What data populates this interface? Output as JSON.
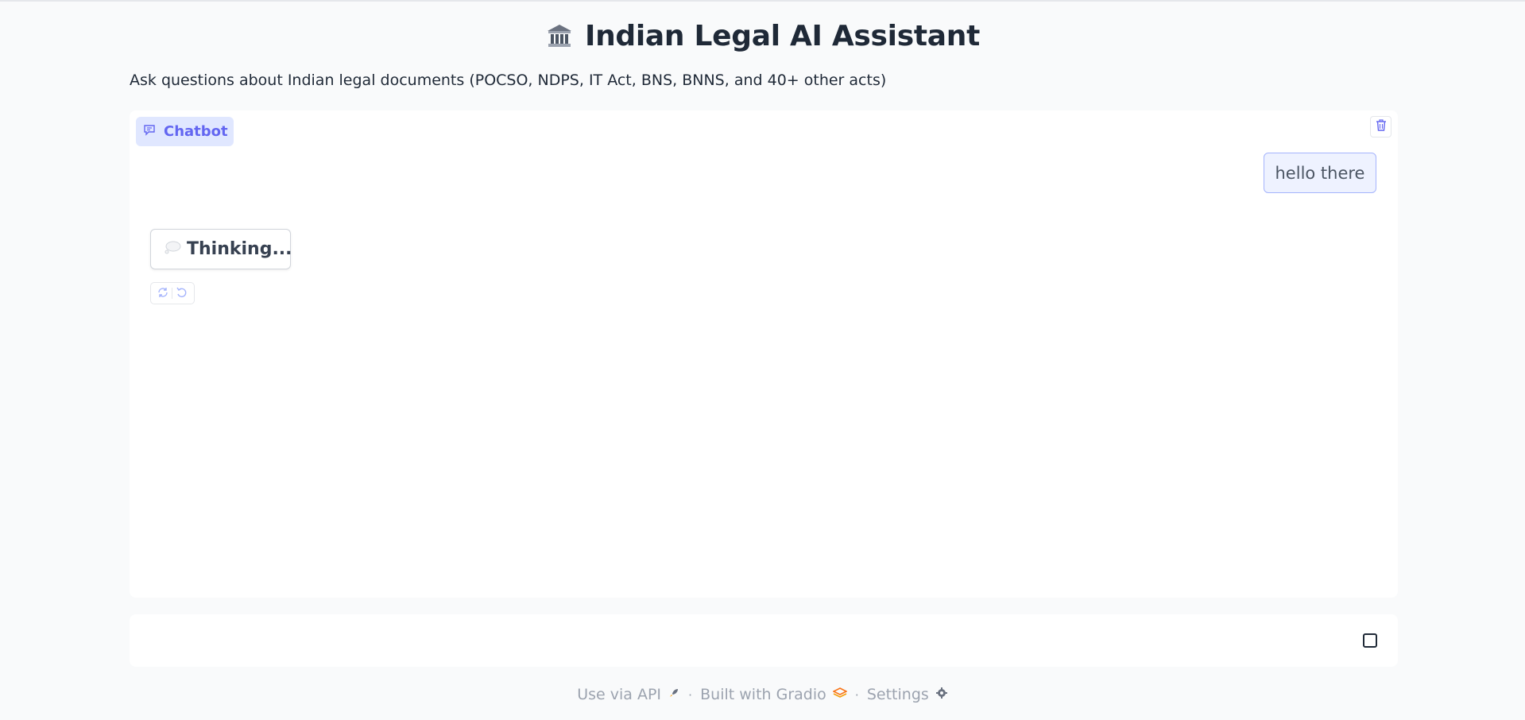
{
  "header": {
    "title": "Indian Legal AI Assistant",
    "subtitle": "Ask questions about Indian legal documents (POCSO, NDPS, IT Act, BNS, BNNS, and 40+ other acts)",
    "icon": "classical-building-icon"
  },
  "chatbot": {
    "label": "Chatbot",
    "label_icon": "chat-icon",
    "clear_icon": "trash-icon",
    "messages": [
      {
        "role": "user",
        "text": "hello there"
      },
      {
        "role": "assistant",
        "text": "Thinking...",
        "icon": "thought-bubble-icon"
      }
    ],
    "actions": [
      "retry-icon",
      "undo-icon"
    ]
  },
  "input": {
    "value": "",
    "placeholder": "",
    "stop_icon": "stop-icon"
  },
  "footer": {
    "api_label": "Use via API",
    "api_icon": "rocket-icon",
    "built_label": "Built with Gradio",
    "built_icon": "gradio-logo-icon",
    "settings_label": "Settings",
    "settings_icon": "gear-icon",
    "separator": "·"
  },
  "colors": {
    "accent": "#6366f1",
    "accent_bg": "#e0e7ff",
    "page_bg": "#f9fafb",
    "panel_bg": "#ffffff"
  }
}
